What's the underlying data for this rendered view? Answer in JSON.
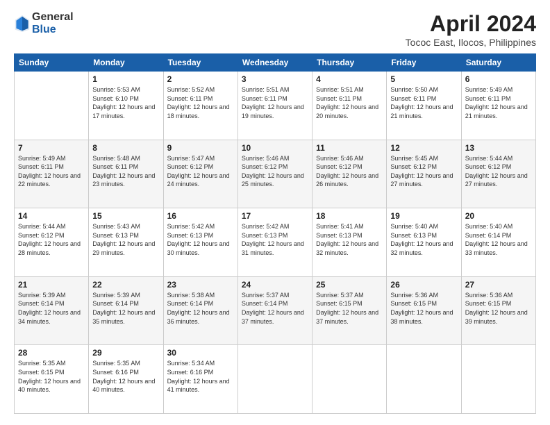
{
  "header": {
    "logo_general": "General",
    "logo_blue": "Blue",
    "month_title": "April 2024",
    "location": "Tococ East, Ilocos, Philippines"
  },
  "weekdays": [
    "Sunday",
    "Monday",
    "Tuesday",
    "Wednesday",
    "Thursday",
    "Friday",
    "Saturday"
  ],
  "weeks": [
    [
      {
        "day": "",
        "sunrise": "",
        "sunset": "",
        "daylight": ""
      },
      {
        "day": "1",
        "sunrise": "Sunrise: 5:53 AM",
        "sunset": "Sunset: 6:10 PM",
        "daylight": "Daylight: 12 hours and 17 minutes."
      },
      {
        "day": "2",
        "sunrise": "Sunrise: 5:52 AM",
        "sunset": "Sunset: 6:11 PM",
        "daylight": "Daylight: 12 hours and 18 minutes."
      },
      {
        "day": "3",
        "sunrise": "Sunrise: 5:51 AM",
        "sunset": "Sunset: 6:11 PM",
        "daylight": "Daylight: 12 hours and 19 minutes."
      },
      {
        "day": "4",
        "sunrise": "Sunrise: 5:51 AM",
        "sunset": "Sunset: 6:11 PM",
        "daylight": "Daylight: 12 hours and 20 minutes."
      },
      {
        "day": "5",
        "sunrise": "Sunrise: 5:50 AM",
        "sunset": "Sunset: 6:11 PM",
        "daylight": "Daylight: 12 hours and 21 minutes."
      },
      {
        "day": "6",
        "sunrise": "Sunrise: 5:49 AM",
        "sunset": "Sunset: 6:11 PM",
        "daylight": "Daylight: 12 hours and 21 minutes."
      }
    ],
    [
      {
        "day": "7",
        "sunrise": "Sunrise: 5:49 AM",
        "sunset": "Sunset: 6:11 PM",
        "daylight": "Daylight: 12 hours and 22 minutes."
      },
      {
        "day": "8",
        "sunrise": "Sunrise: 5:48 AM",
        "sunset": "Sunset: 6:11 PM",
        "daylight": "Daylight: 12 hours and 23 minutes."
      },
      {
        "day": "9",
        "sunrise": "Sunrise: 5:47 AM",
        "sunset": "Sunset: 6:12 PM",
        "daylight": "Daylight: 12 hours and 24 minutes."
      },
      {
        "day": "10",
        "sunrise": "Sunrise: 5:46 AM",
        "sunset": "Sunset: 6:12 PM",
        "daylight": "Daylight: 12 hours and 25 minutes."
      },
      {
        "day": "11",
        "sunrise": "Sunrise: 5:46 AM",
        "sunset": "Sunset: 6:12 PM",
        "daylight": "Daylight: 12 hours and 26 minutes."
      },
      {
        "day": "12",
        "sunrise": "Sunrise: 5:45 AM",
        "sunset": "Sunset: 6:12 PM",
        "daylight": "Daylight: 12 hours and 27 minutes."
      },
      {
        "day": "13",
        "sunrise": "Sunrise: 5:44 AM",
        "sunset": "Sunset: 6:12 PM",
        "daylight": "Daylight: 12 hours and 27 minutes."
      }
    ],
    [
      {
        "day": "14",
        "sunrise": "Sunrise: 5:44 AM",
        "sunset": "Sunset: 6:12 PM",
        "daylight": "Daylight: 12 hours and 28 minutes."
      },
      {
        "day": "15",
        "sunrise": "Sunrise: 5:43 AM",
        "sunset": "Sunset: 6:13 PM",
        "daylight": "Daylight: 12 hours and 29 minutes."
      },
      {
        "day": "16",
        "sunrise": "Sunrise: 5:42 AM",
        "sunset": "Sunset: 6:13 PM",
        "daylight": "Daylight: 12 hours and 30 minutes."
      },
      {
        "day": "17",
        "sunrise": "Sunrise: 5:42 AM",
        "sunset": "Sunset: 6:13 PM",
        "daylight": "Daylight: 12 hours and 31 minutes."
      },
      {
        "day": "18",
        "sunrise": "Sunrise: 5:41 AM",
        "sunset": "Sunset: 6:13 PM",
        "daylight": "Daylight: 12 hours and 32 minutes."
      },
      {
        "day": "19",
        "sunrise": "Sunrise: 5:40 AM",
        "sunset": "Sunset: 6:13 PM",
        "daylight": "Daylight: 12 hours and 32 minutes."
      },
      {
        "day": "20",
        "sunrise": "Sunrise: 5:40 AM",
        "sunset": "Sunset: 6:14 PM",
        "daylight": "Daylight: 12 hours and 33 minutes."
      }
    ],
    [
      {
        "day": "21",
        "sunrise": "Sunrise: 5:39 AM",
        "sunset": "Sunset: 6:14 PM",
        "daylight": "Daylight: 12 hours and 34 minutes."
      },
      {
        "day": "22",
        "sunrise": "Sunrise: 5:39 AM",
        "sunset": "Sunset: 6:14 PM",
        "daylight": "Daylight: 12 hours and 35 minutes."
      },
      {
        "day": "23",
        "sunrise": "Sunrise: 5:38 AM",
        "sunset": "Sunset: 6:14 PM",
        "daylight": "Daylight: 12 hours and 36 minutes."
      },
      {
        "day": "24",
        "sunrise": "Sunrise: 5:37 AM",
        "sunset": "Sunset: 6:14 PM",
        "daylight": "Daylight: 12 hours and 37 minutes."
      },
      {
        "day": "25",
        "sunrise": "Sunrise: 5:37 AM",
        "sunset": "Sunset: 6:15 PM",
        "daylight": "Daylight: 12 hours and 37 minutes."
      },
      {
        "day": "26",
        "sunrise": "Sunrise: 5:36 AM",
        "sunset": "Sunset: 6:15 PM",
        "daylight": "Daylight: 12 hours and 38 minutes."
      },
      {
        "day": "27",
        "sunrise": "Sunrise: 5:36 AM",
        "sunset": "Sunset: 6:15 PM",
        "daylight": "Daylight: 12 hours and 39 minutes."
      }
    ],
    [
      {
        "day": "28",
        "sunrise": "Sunrise: 5:35 AM",
        "sunset": "Sunset: 6:15 PM",
        "daylight": "Daylight: 12 hours and 40 minutes."
      },
      {
        "day": "29",
        "sunrise": "Sunrise: 5:35 AM",
        "sunset": "Sunset: 6:16 PM",
        "daylight": "Daylight: 12 hours and 40 minutes."
      },
      {
        "day": "30",
        "sunrise": "Sunrise: 5:34 AM",
        "sunset": "Sunset: 6:16 PM",
        "daylight": "Daylight: 12 hours and 41 minutes."
      },
      {
        "day": "",
        "sunrise": "",
        "sunset": "",
        "daylight": ""
      },
      {
        "day": "",
        "sunrise": "",
        "sunset": "",
        "daylight": ""
      },
      {
        "day": "",
        "sunrise": "",
        "sunset": "",
        "daylight": ""
      },
      {
        "day": "",
        "sunrise": "",
        "sunset": "",
        "daylight": ""
      }
    ]
  ]
}
